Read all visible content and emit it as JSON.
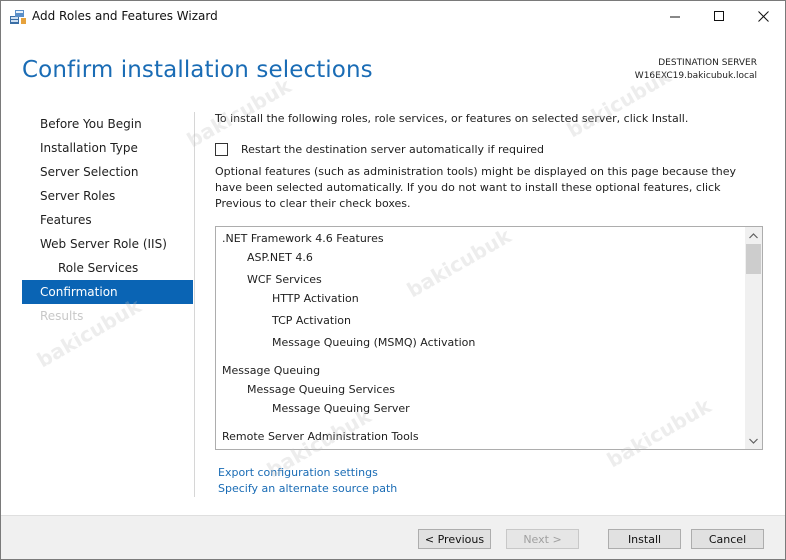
{
  "window": {
    "title": "Add Roles and Features Wizard"
  },
  "header": {
    "page_title": "Confirm installation selections",
    "destination_label": "DESTINATION SERVER",
    "destination_server": "W16EXC19.bakicubuk.local"
  },
  "nav": {
    "items": [
      {
        "label": "Before You Begin",
        "state": "normal"
      },
      {
        "label": "Installation Type",
        "state": "normal"
      },
      {
        "label": "Server Selection",
        "state": "normal"
      },
      {
        "label": "Server Roles",
        "state": "normal"
      },
      {
        "label": "Features",
        "state": "normal"
      },
      {
        "label": "Web Server Role (IIS)",
        "state": "normal"
      },
      {
        "label": "Role Services",
        "state": "sub"
      },
      {
        "label": "Confirmation",
        "state": "active"
      },
      {
        "label": "Results",
        "state": "disabled"
      }
    ]
  },
  "content": {
    "intro": "To install the following roles, role services, or features on selected server, click Install.",
    "restart_checkbox_label": "Restart the destination server automatically if required",
    "restart_checked": false,
    "optional_text": "Optional features (such as administration tools) might be displayed on this page because they have been selected automatically. If you do not want to install these optional features, click Previous to clear their check boxes.",
    "features": [
      {
        "label": ".NET Framework 4.6 Features",
        "level": 0
      },
      {
        "label": "ASP.NET 4.6",
        "level": 1
      },
      {
        "label": "WCF Services",
        "level": 1
      },
      {
        "label": "HTTP Activation",
        "level": 2
      },
      {
        "label": "TCP Activation",
        "level": 2
      },
      {
        "label": "Message Queuing (MSMQ) Activation",
        "level": 2
      },
      {
        "label": "Message Queuing",
        "level": 0
      },
      {
        "label": "Message Queuing Services",
        "level": 1
      },
      {
        "label": "Message Queuing Server",
        "level": 2
      },
      {
        "label": "Remote Server Administration Tools",
        "level": 0
      }
    ],
    "export_link": "Export configuration settings",
    "alt_source_link": "Specify an alternate source path"
  },
  "footer": {
    "previous": "< Previous",
    "next": "Next >",
    "install": "Install",
    "cancel": "Cancel"
  },
  "watermark": "bakicubuk",
  "colors": {
    "accent": "#1a6cb5",
    "active_nav": "#0a64b4",
    "footer_bg": "#f0f0f0"
  }
}
